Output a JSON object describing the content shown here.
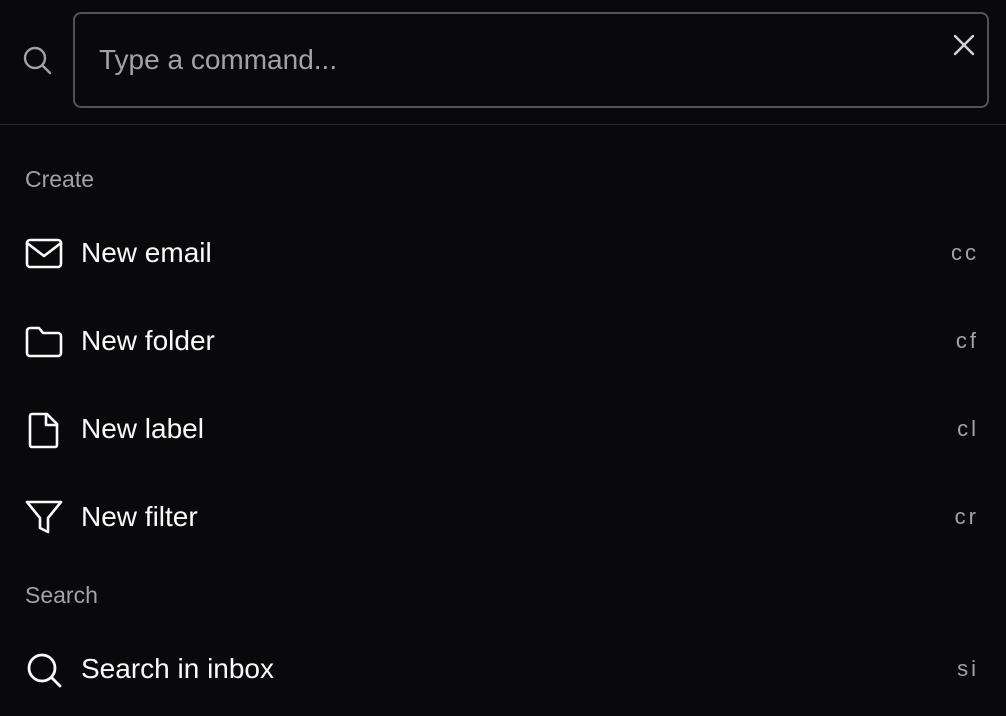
{
  "search": {
    "placeholder": "Type a command...",
    "value": ""
  },
  "groups": {
    "create": {
      "heading": "Create",
      "items": [
        {
          "label": "New email",
          "shortcut": "cc",
          "icon": "mail-icon"
        },
        {
          "label": "New folder",
          "shortcut": "cf",
          "icon": "folder-icon"
        },
        {
          "label": "New label",
          "shortcut": "cl",
          "icon": "file-icon"
        },
        {
          "label": "New filter",
          "shortcut": "cr",
          "icon": "filter-icon"
        }
      ]
    },
    "search": {
      "heading": "Search",
      "items": [
        {
          "label": "Search in inbox",
          "shortcut": "si",
          "icon": "search-icon"
        }
      ]
    }
  },
  "colors": {
    "background": "#09090b",
    "border": "#27272a",
    "input_border": "#52525b",
    "text": "#fafafa",
    "muted": "#a1a1aa"
  }
}
